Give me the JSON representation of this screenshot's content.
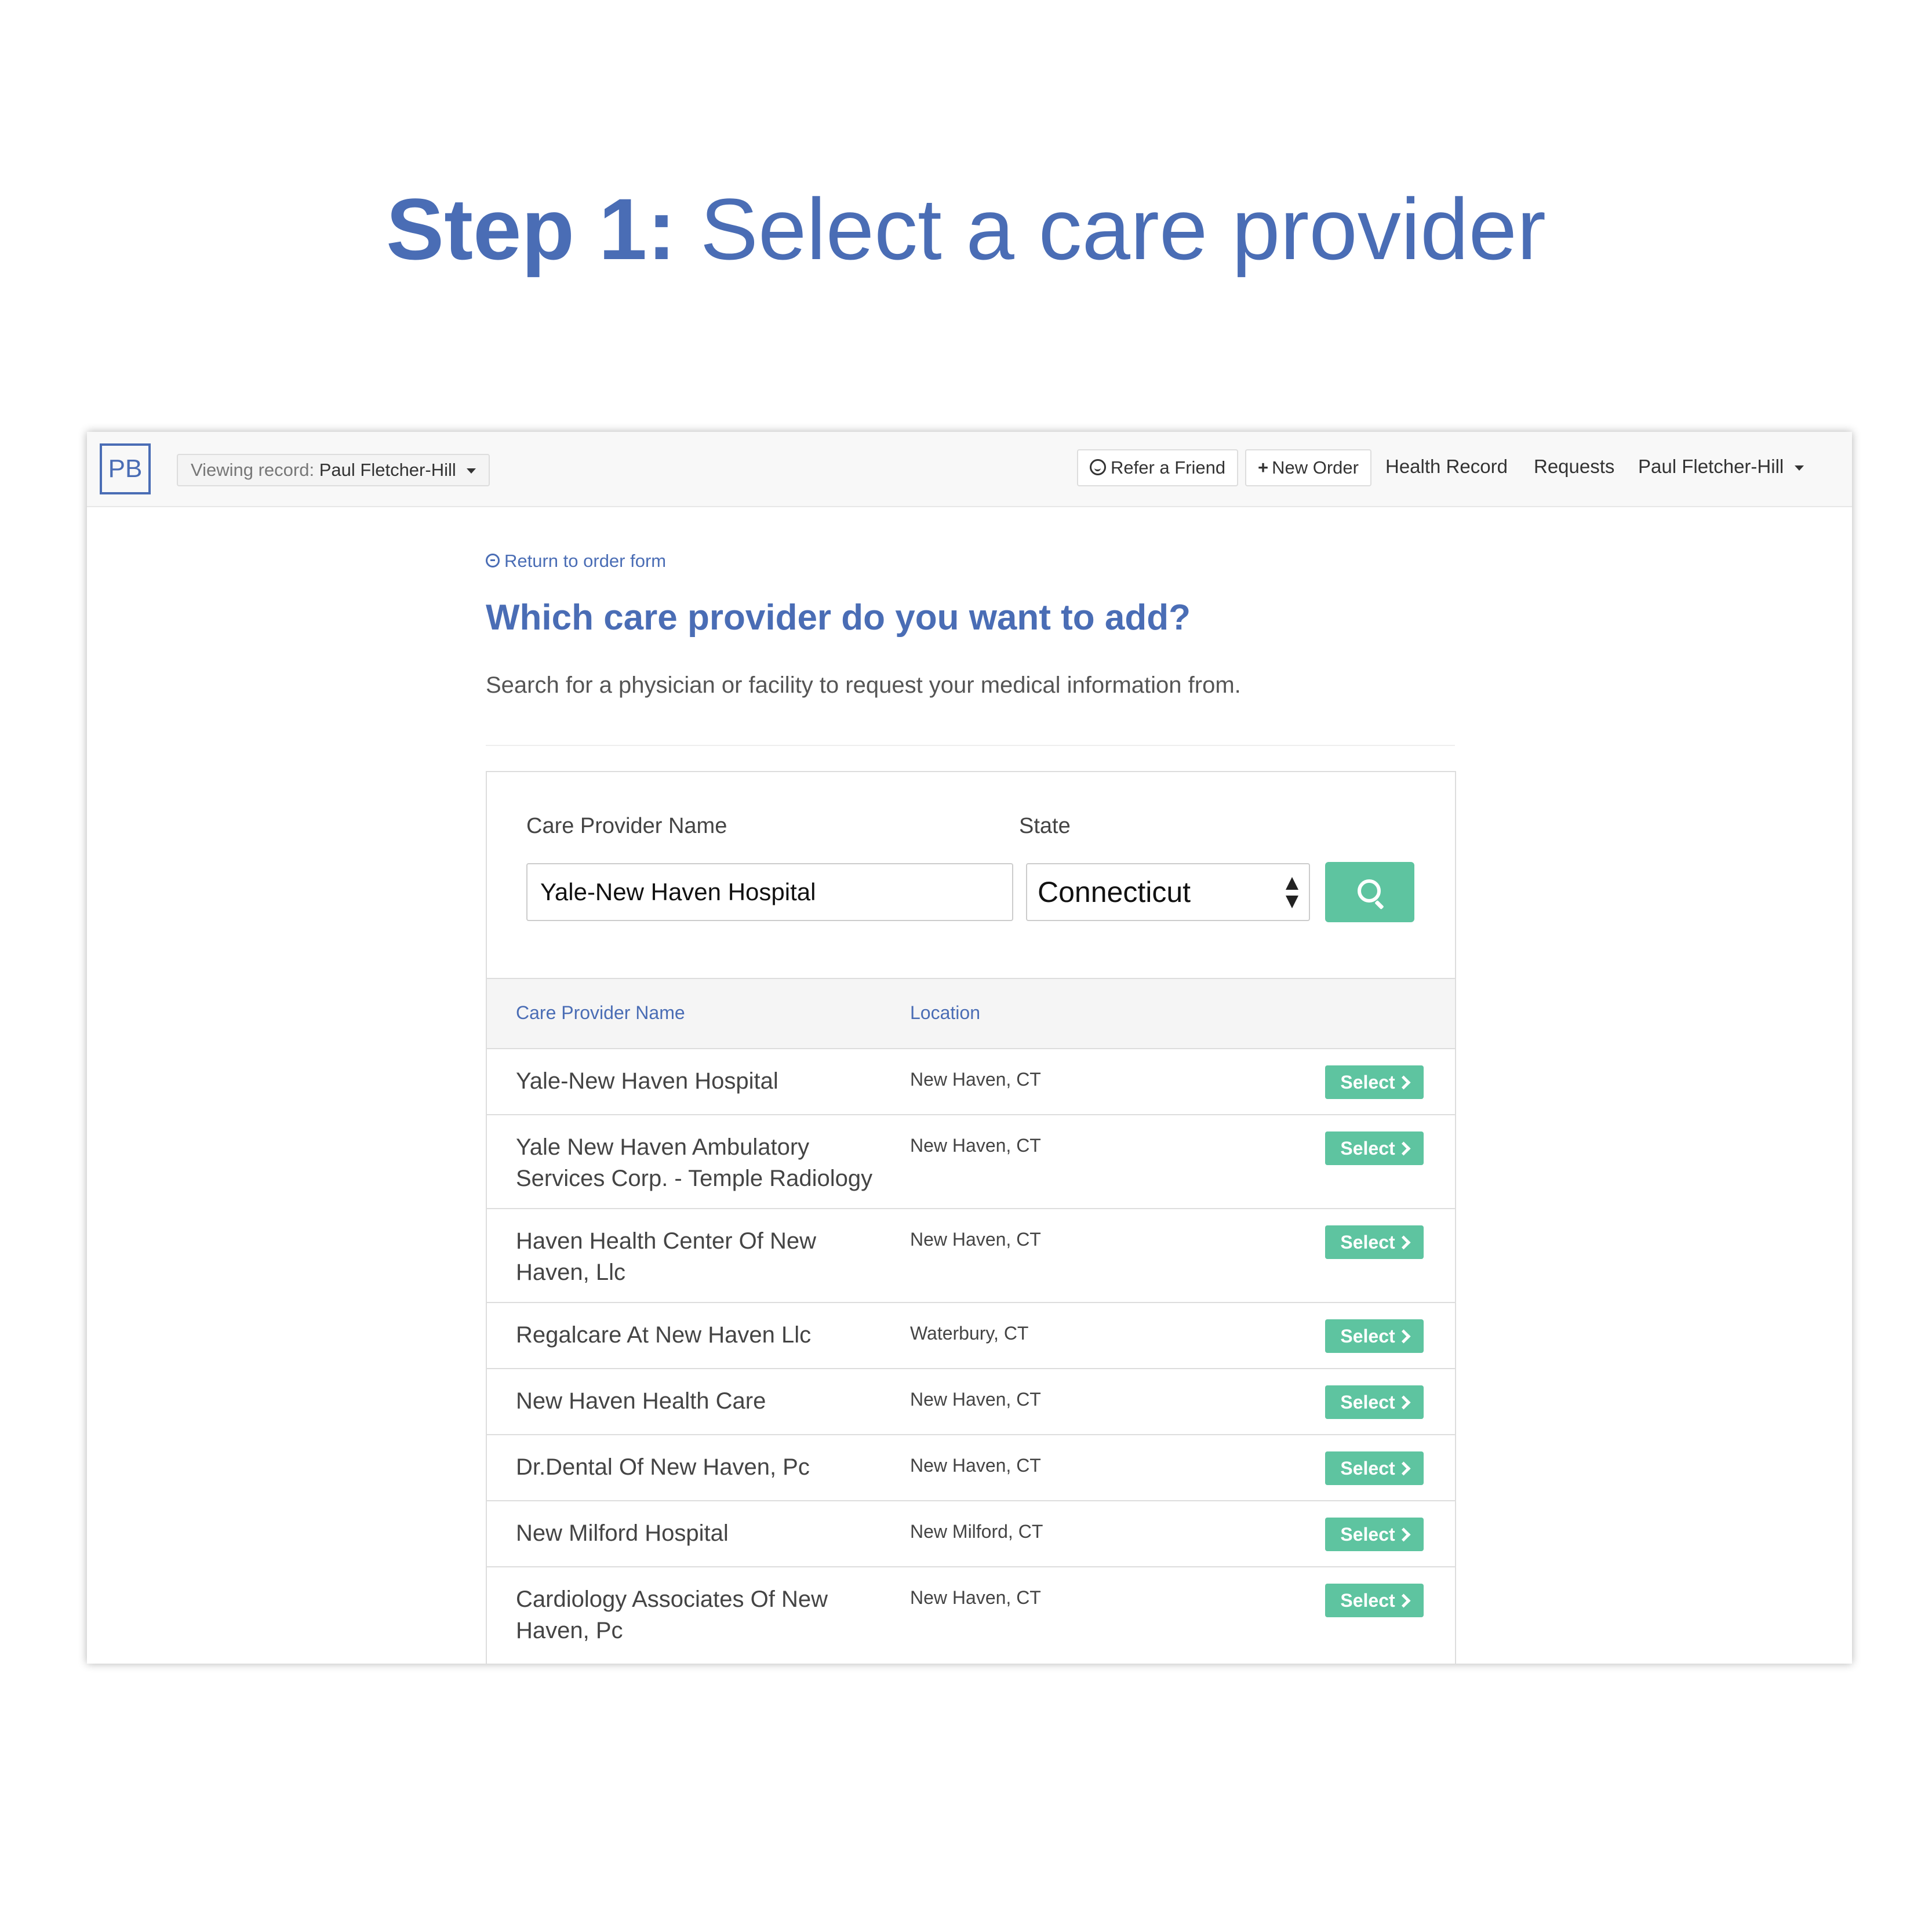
{
  "step": {
    "prefix": "Step 1:",
    "title": "Select a care provider"
  },
  "navbar": {
    "logo": "PB",
    "viewing_label": "Viewing record:",
    "viewing_name": "Paul Fletcher-Hill",
    "refer_label": "Refer a Friend",
    "new_order_label": "New Order",
    "health_record_label": "Health Record",
    "requests_label": "Requests",
    "user_name": "Paul Fletcher-Hill"
  },
  "content": {
    "return_link": "Return to order form",
    "heading": "Which care provider do you want to add?",
    "subtitle": "Search for a physician or facility to request your medical information from."
  },
  "search": {
    "name_label": "Care Provider Name",
    "name_value": "Yale-New Haven Hospital",
    "state_label": "State",
    "state_value": "Connecticut"
  },
  "table": {
    "headers": [
      "Care Provider Name",
      "Location"
    ],
    "select_label": "Select",
    "rows": [
      {
        "name": "Yale-New Haven Hospital",
        "location": "New Haven, CT"
      },
      {
        "name": "Yale New Haven Ambulatory Services Corp. - Temple Radiology",
        "location": "New Haven, CT"
      },
      {
        "name": "Haven Health Center Of New Haven, Llc",
        "location": "New Haven, CT"
      },
      {
        "name": "Regalcare At New Haven Llc",
        "location": "Waterbury, CT"
      },
      {
        "name": "New Haven Health Care",
        "location": "New Haven, CT"
      },
      {
        "name": "Dr.Dental Of New Haven, Pc",
        "location": "New Haven, CT"
      },
      {
        "name": "New Milford Hospital",
        "location": "New Milford, CT"
      },
      {
        "name": "Cardiology Associates Of New Haven, Pc",
        "location": "New Haven, CT"
      }
    ]
  },
  "colors": {
    "brand_blue": "#4a6db5",
    "accent_green": "#5ec4a0"
  }
}
